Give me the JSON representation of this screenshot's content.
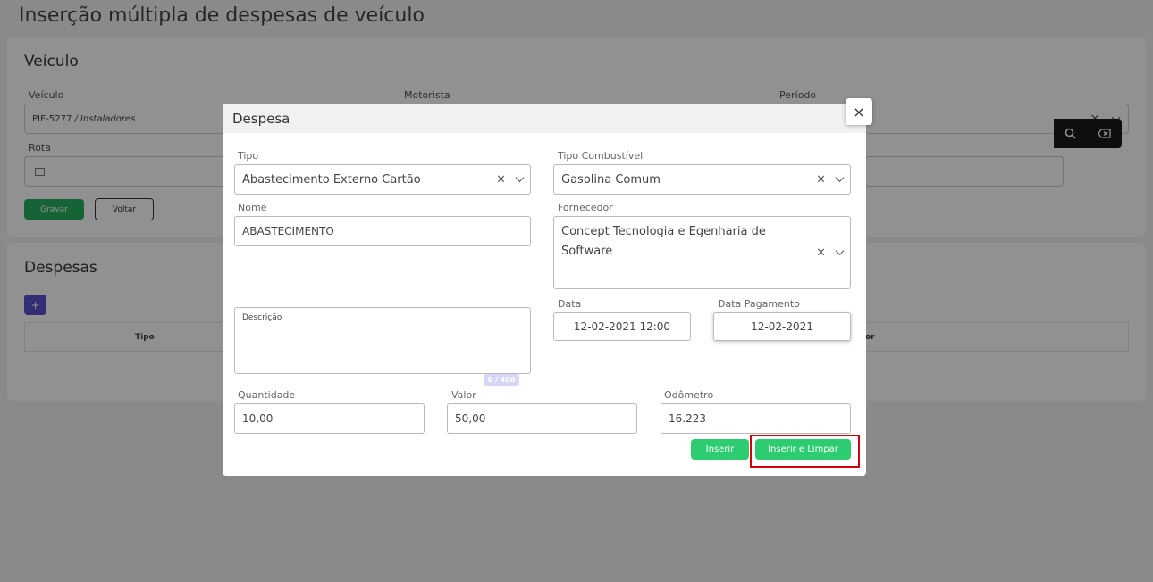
{
  "page": {
    "title": "Inserção múltipla de despesas de veículo"
  },
  "veiculo_card": {
    "title": "Veículo",
    "veiculo_label": "Veículo",
    "veiculo_value": "PIE-5277",
    "veiculo_value_suffix": "/ Instaladores",
    "motorista_label": "Motorista",
    "periodo_label": "Período",
    "rota_label": "Rota",
    "gravar_label": "Gravar",
    "voltar_label": "Voltar"
  },
  "despesas_card": {
    "title": "Despesas",
    "add_label": "+",
    "columns": [
      "Tipo",
      "or"
    ]
  },
  "modal": {
    "title": "Despesa",
    "close_label": "×",
    "tipo_label": "Tipo",
    "tipo_value": "Abastecimento Externo Cartão",
    "tipo_combustivel_label": "Tipo Combustível",
    "tipo_combustivel_value": "Gasolina Comum",
    "nome_label": "Nome",
    "nome_value": "ABASTECIMENTO",
    "fornecedor_label": "Fornecedor",
    "fornecedor_value": "Concept Tecnologia e Egenharia de Software",
    "descricao_label": "Descrição",
    "descricao_counter": "0 / 400",
    "data_label": "Data",
    "data_value": "12-02-2021 12:00",
    "data_pagamento_label": "Data Pagamento",
    "data_pagamento_value": "12-02-2021",
    "quantidade_label": "Quantidade",
    "quantidade_value": "10,00",
    "valor_label": "Valor",
    "valor_value": "50,00",
    "odometro_label": "Odômetro",
    "odometro_value": "16.223",
    "inserir_label": "Inserir",
    "inserir_limpar_label": "Inserir e Limpar"
  },
  "colors": {
    "primary_green": "#2ecc71",
    "save_green": "#27ae60",
    "add_purple": "#5a4fcf",
    "highlight_red": "#d3000a"
  }
}
